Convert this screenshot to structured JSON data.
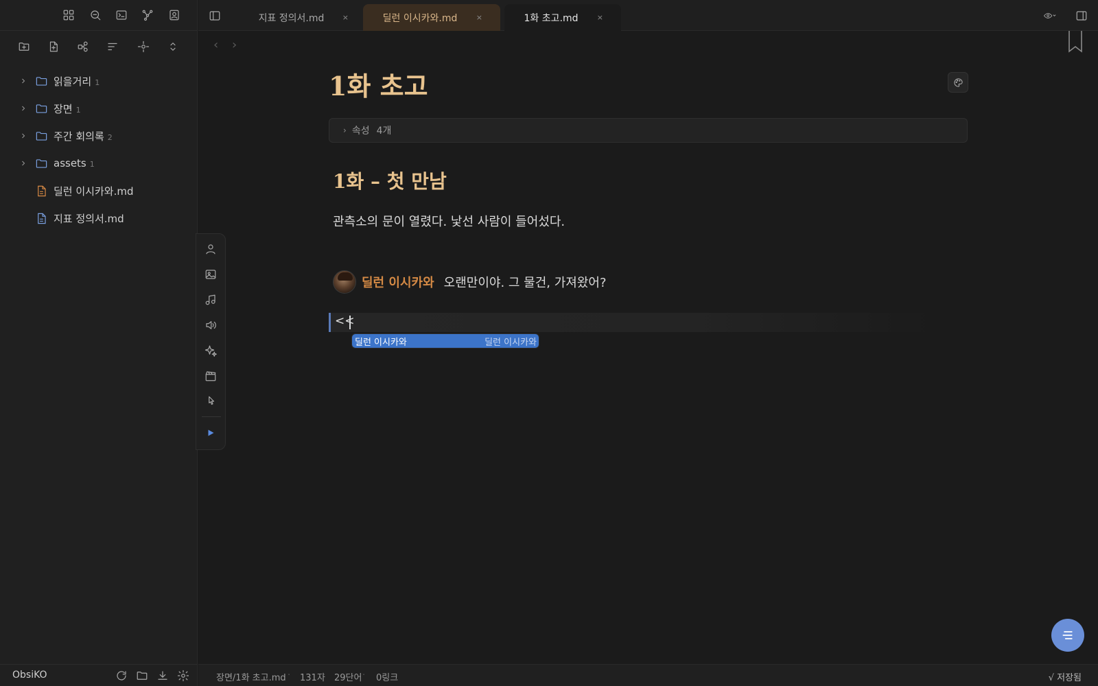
{
  "ribbon": {
    "icons": [
      "layout-grid-icon",
      "search-icon",
      "terminal-icon",
      "graph-icon",
      "contact-icon"
    ]
  },
  "file_nav": {
    "actions": [
      "new-folder-icon",
      "new-file-icon",
      "canvas-icon",
      "sort-icon",
      "locate-icon",
      "expand-collapse-icon"
    ],
    "items": [
      {
        "type": "folder",
        "label": "읽을거리",
        "count": "1"
      },
      {
        "type": "folder",
        "label": "장면",
        "count": "1"
      },
      {
        "type": "folder",
        "label": "주간 회의록",
        "count": "2"
      },
      {
        "type": "folder",
        "label": "assets",
        "count": "1"
      },
      {
        "type": "file",
        "label": "딜런 이시카와.md",
        "count": ""
      },
      {
        "type": "file",
        "label": "지표 정의서.md",
        "count": ""
      }
    ]
  },
  "vault": {
    "name": "ObsiKO"
  },
  "tabs": [
    {
      "label": "지표 정의서.md",
      "close": "×"
    },
    {
      "label": "딜런 이시카와.md",
      "close": "×"
    },
    {
      "label": "1화 초고.md",
      "close": "×"
    }
  ],
  "editor": {
    "title": "1화 초고",
    "properties": {
      "label": "속성",
      "count": "4개"
    },
    "heading": "1화 – 첫 만남",
    "paragraph": "관측소의 문이 열렸다. 낯선 사람이 들어섰다.",
    "dialogue": {
      "speaker": "딜런 이시카와",
      "line": "오랜만이야. 그 물건, 가져왔어?"
    },
    "input_text": "<<",
    "suggestion": {
      "label": "딜런 이시카와",
      "detail": "딜런 이시카와"
    },
    "nav": {
      "back": "‹",
      "forward": "›"
    }
  },
  "block_toolbar": [
    "person-icon",
    "image-icon",
    "music-icon",
    "volume-icon",
    "sparkles-icon",
    "clapperboard-icon",
    "cursor-click-icon",
    "play-icon"
  ],
  "status": {
    "path": "장면/1화 초고.md",
    "chars": "131자",
    "words": "29단어",
    "links": "0링크",
    "saved": "√ 저장됨"
  },
  "colors": {
    "accent": "#3c74c9",
    "title": "#e8c38e",
    "speaker": "#d58a45",
    "fab": "#6a8fd8"
  }
}
